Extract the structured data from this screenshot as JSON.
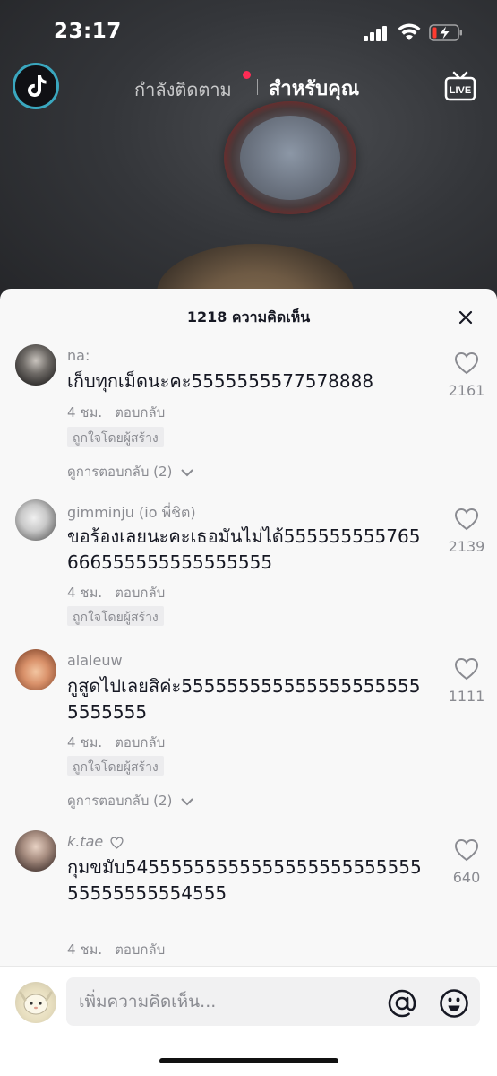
{
  "status": {
    "time": "23:17"
  },
  "nav": {
    "following_tab": "กำลังติดตาม",
    "for_you_tab": "สำหรับคุณ",
    "live_label": "LIVE"
  },
  "sheet": {
    "title": "1218 ความคิดเห็น"
  },
  "comments": [
    {
      "username": "na:",
      "text": "เก็บทุกเม็ดนะคะ5555555577578888",
      "time": "4 ชม.",
      "reply_label": "ตอบกลับ",
      "badge": "ถูกใจโดยผู้สร้าง",
      "view_replies": "ดูการตอบกลับ (2)",
      "likes": "2161"
    },
    {
      "username": "gimminju (io พี่ชิต)",
      "text": "ขอร้องเลยนะคะเธอมันไม่ได้555555555765666555555555555555",
      "time": "4 ชม.",
      "reply_label": "ตอบกลับ",
      "badge": "ถูกใจโดยผู้สร้าง",
      "likes": "2139"
    },
    {
      "username": "alaleuw",
      "text": "กูสูดไปเลยสิค่ะ5555555555555555555555555555",
      "time": "4 ชม.",
      "reply_label": "ตอบกลับ",
      "badge": "ถูกใจโดยผู้สร้าง",
      "view_replies": "ดูการตอบกลับ (2)",
      "likes": "1111"
    },
    {
      "username": "k.tae",
      "text": "กุมขมับ5455555555555555555555555555555555554555",
      "time": "4 ชม.",
      "reply_label": "ตอบกลับ",
      "likes": "640"
    }
  ],
  "input": {
    "placeholder": "เพิ่มความคิดเห็น..."
  }
}
